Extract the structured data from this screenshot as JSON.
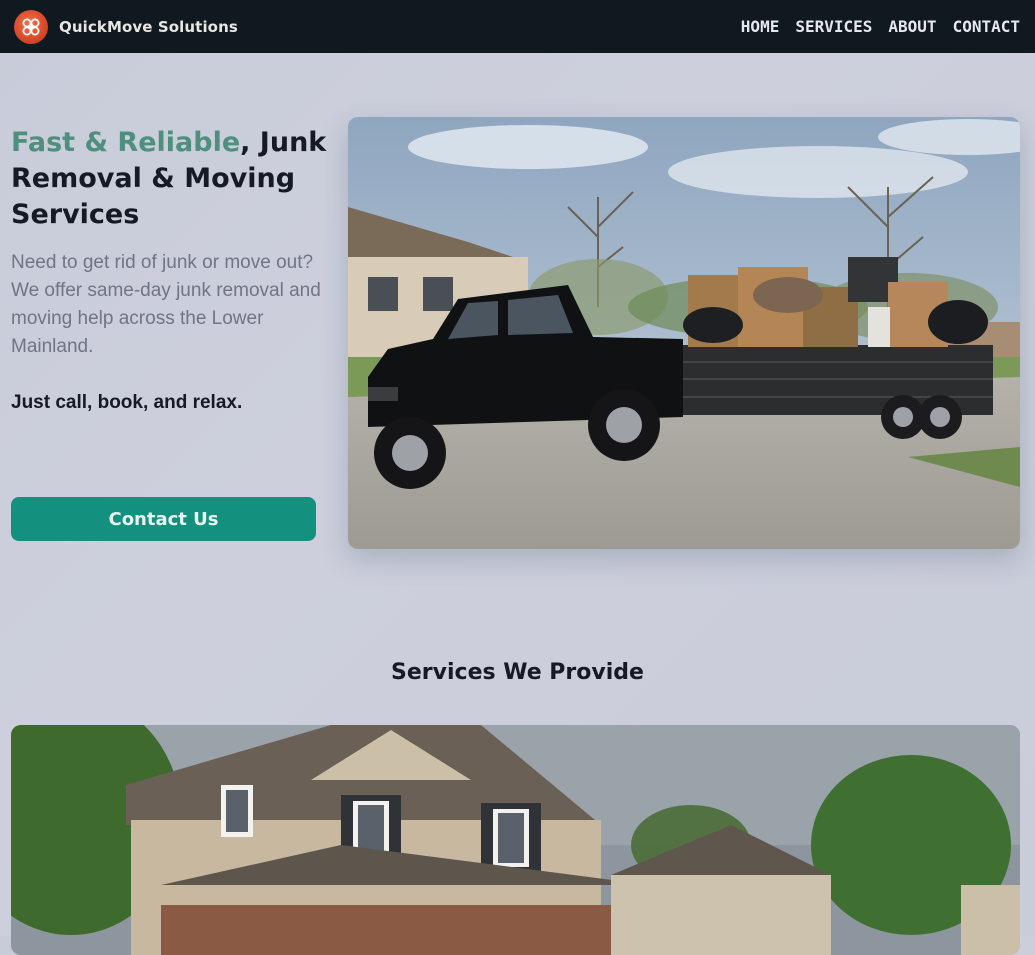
{
  "nav": {
    "brand": "QuickMove Solutions",
    "links": [
      "HOME",
      "SERVICES",
      "ABOUT",
      "CONTACT"
    ]
  },
  "hero": {
    "title_accent": "Fast & Reliable",
    "title_rest": ", Junk Removal & Moving Services",
    "description_line1": "Need to get rid of junk or move out?",
    "description_line2": "We offer same-day junk removal and moving help across the Lower Mainland.",
    "tagline": "Just call, book, and relax.",
    "cta_label": "Contact Us"
  },
  "services": {
    "heading": "Services We Provide"
  },
  "colors": {
    "nav_bg": "#101820",
    "accent": "#4f8f7e",
    "button": "#14907f",
    "page_bg": "#c9ccd9"
  },
  "icons": {
    "logo": "logo-icon",
    "hero_image": "pickup-truck-trailer-photo",
    "services_image": "house-photo"
  }
}
